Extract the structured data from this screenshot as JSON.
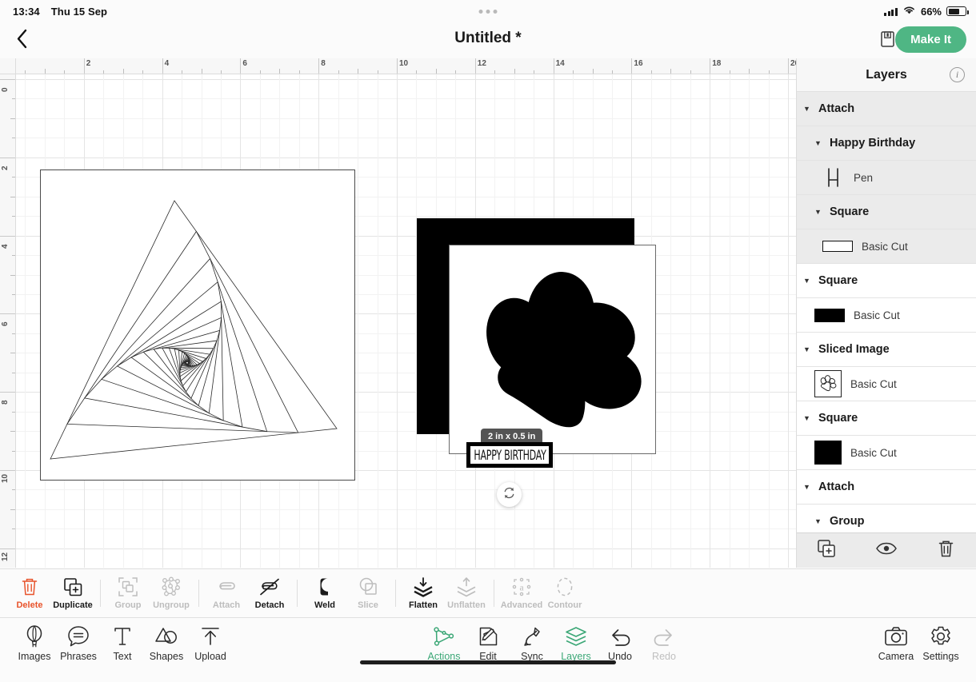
{
  "statusbar": {
    "time": "13:34",
    "date": "Thu 15 Sep",
    "battery_percent": "66%",
    "wifi_icon": "wifi-icon",
    "signal_icon": "cellular-signal-icon",
    "battery_icon": "battery-icon"
  },
  "topnav": {
    "back_icon": "back-chevron-icon",
    "title": "Untitled *",
    "save_icon": "save-floppy-icon",
    "make_it_label": "Make It",
    "accent_green": "#4FB684"
  },
  "canvas": {
    "ruler_h_labels": [
      "2",
      "4",
      "6",
      "8",
      "10",
      "12",
      "14",
      "16",
      "18",
      "20"
    ],
    "ruler_v_labels": [
      "0",
      "2",
      "4",
      "6",
      "8",
      "10",
      "12"
    ],
    "size_badge": "2 in x 0.5 in",
    "text_object": "HAPPY BIRTHDAY",
    "rotate_icon": "rotate-handle-icon",
    "objects": [
      {
        "name": "string-art-square",
        "type": "framed-triangle-spiral"
      },
      {
        "name": "black-square",
        "type": "filled-square",
        "color": "#000000"
      },
      {
        "name": "white-square-with-paw",
        "type": "square-with-paw",
        "color": "#FFFFFF"
      }
    ]
  },
  "layers": {
    "title": "Layers",
    "info_icon": "info-icon",
    "items": [
      {
        "name": "Attach",
        "level": 0,
        "kind": "group",
        "shaded": true,
        "caret": "▼"
      },
      {
        "name": "Happy Birthday",
        "level": 1,
        "kind": "group",
        "shaded": true,
        "caret": "▼"
      },
      {
        "name": "Pen",
        "level": 2,
        "kind": "layer",
        "shaded": true,
        "swatch": "pen-stroke-swatch"
      },
      {
        "name": "Square",
        "level": 1,
        "kind": "group",
        "shaded": true,
        "caret": "▼"
      },
      {
        "name": "Basic Cut",
        "level": 2,
        "kind": "layer",
        "shaded": true,
        "swatch": "white-outline-swatch"
      },
      {
        "name": "Square",
        "level": 0,
        "kind": "group",
        "shaded": false,
        "caret": "▼"
      },
      {
        "name": "Basic Cut",
        "level": 1,
        "kind": "layer",
        "shaded": false,
        "swatch": "black-bar-swatch"
      },
      {
        "name": "Sliced Image",
        "level": 0,
        "kind": "group",
        "shaded": false,
        "caret": "▼"
      },
      {
        "name": "Basic Cut",
        "level": 1,
        "kind": "layer",
        "shaded": false,
        "swatch": "paw-thumbnail-swatch"
      },
      {
        "name": "Square",
        "level": 0,
        "kind": "group",
        "shaded": false,
        "caret": "▼"
      },
      {
        "name": "Basic Cut",
        "level": 1,
        "kind": "layer",
        "shaded": false,
        "swatch": "black-square-swatch"
      },
      {
        "name": "Attach",
        "level": 0,
        "kind": "group",
        "shaded": false,
        "caret": "▼"
      },
      {
        "name": "Group",
        "level": 1,
        "kind": "group",
        "shaded": false,
        "caret": "▼"
      }
    ],
    "footer": [
      {
        "label": "duplicate-layer",
        "icon": "duplicate-icon"
      },
      {
        "label": "toggle-visibility",
        "icon": "eye-icon"
      },
      {
        "label": "delete-layer",
        "icon": "trash-icon"
      }
    ]
  },
  "actionbar": {
    "items": [
      {
        "label": "Delete",
        "icon": "trash-icon",
        "state": "danger"
      },
      {
        "label": "Duplicate",
        "icon": "duplicate-icon",
        "state": "on"
      },
      {
        "label": "Group",
        "icon": "group-icon",
        "state": "off"
      },
      {
        "label": "Ungroup",
        "icon": "ungroup-icon",
        "state": "off"
      },
      {
        "label": "Attach",
        "icon": "paperclip-icon",
        "state": "off"
      },
      {
        "label": "Detach",
        "icon": "detach-icon",
        "state": "on"
      },
      {
        "label": "Weld",
        "icon": "weld-icon",
        "state": "on"
      },
      {
        "label": "Slice",
        "icon": "slice-icon",
        "state": "off"
      },
      {
        "label": "Flatten",
        "icon": "flatten-icon",
        "state": "on"
      },
      {
        "label": "Unflatten",
        "icon": "unflatten-icon",
        "state": "off"
      },
      {
        "label": "Advanced",
        "icon": "advanced-icon",
        "state": "off"
      },
      {
        "label": "Contour",
        "icon": "contour-icon",
        "state": "off"
      }
    ]
  },
  "bottomnav": {
    "left": [
      {
        "label": "Images",
        "icon": "balloon-icon",
        "state": "dark"
      },
      {
        "label": "Phrases",
        "icon": "speech-bubble-icon",
        "state": "dark"
      },
      {
        "label": "Text",
        "icon": "text-t-icon",
        "state": "dark"
      },
      {
        "label": "Shapes",
        "icon": "shapes-icon",
        "state": "dark"
      },
      {
        "label": "Upload",
        "icon": "upload-arrow-icon",
        "state": "dark"
      }
    ],
    "center": [
      {
        "label": "Actions",
        "icon": "actions-nodes-icon",
        "state": "green"
      },
      {
        "label": "Edit",
        "icon": "edit-pencil-icon",
        "state": "dark"
      },
      {
        "label": "Sync",
        "icon": "sync-pen-icon",
        "state": "dark"
      },
      {
        "label": "Layers",
        "icon": "layers-stack-icon",
        "state": "green"
      },
      {
        "label": "Undo",
        "icon": "undo-arrow-icon",
        "state": "dark"
      },
      {
        "label": "Redo",
        "icon": "redo-arrow-icon",
        "state": "dim"
      }
    ],
    "right": [
      {
        "label": "Camera",
        "icon": "camera-icon",
        "state": "dark"
      },
      {
        "label": "Settings",
        "icon": "gear-icon",
        "state": "dark"
      }
    ]
  }
}
